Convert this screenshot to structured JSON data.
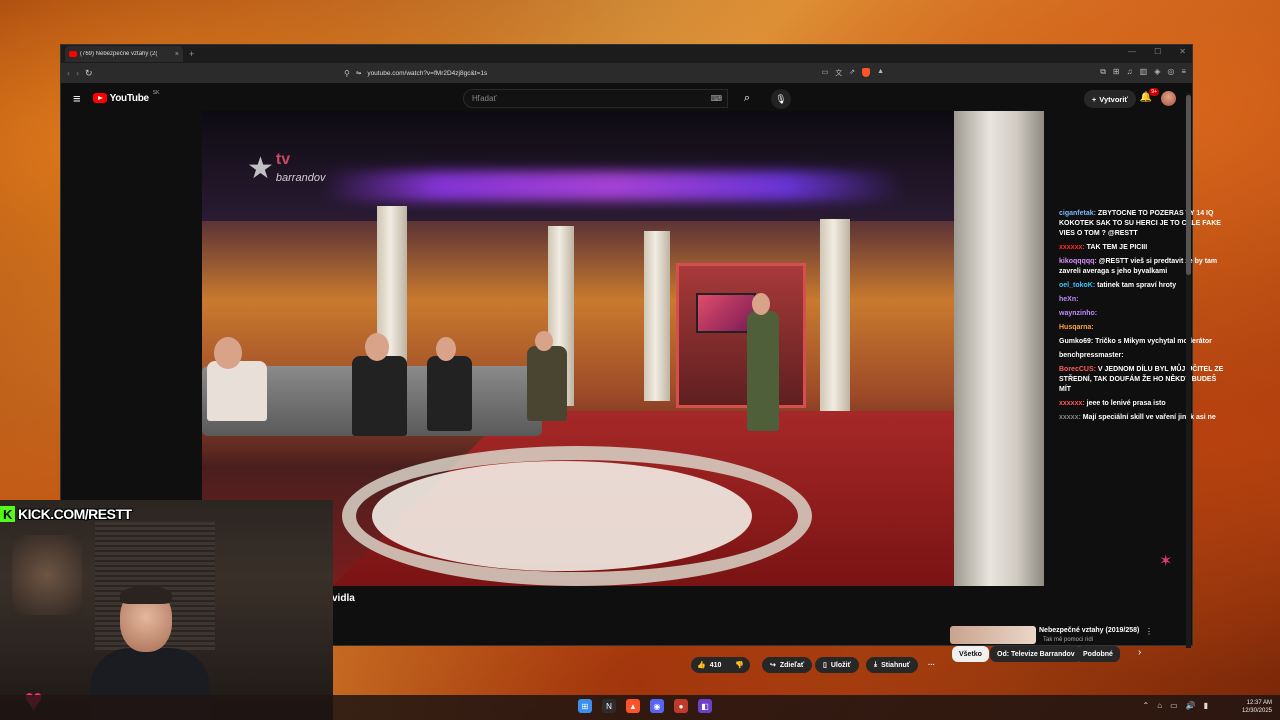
{
  "browser": {
    "tab_title": "(769) Nebezpečné vztahy (2(",
    "tab_close": "×",
    "new_tab": "+",
    "url": "youtube.com/watch?v=fMr2D4zj8gc&t=1s",
    "shield_count": "1"
  },
  "youtube": {
    "logo_text": "YouTube",
    "region": "SK",
    "search_placeholder": "Hľadať",
    "create_label": "Vytvoriť",
    "notif_badge": "9+"
  },
  "video": {
    "watermark_tv": "tv",
    "watermark_name": "barrandov",
    "title_partial": "vidla"
  },
  "chat": [
    {
      "user": "ciganfetak:",
      "text": " ZBYTOCNE TO POZERAS TY 14 IQ KOKOTEK SAK TO SU HERCI JE TO CELE FAKE VIES O TOM ? @RESTT",
      "color": "#7fb6ff"
    },
    {
      "user": "xxxxxx:",
      "text": " TAK TEM JE PICIII",
      "color": "#ff2b2b"
    },
    {
      "user": "kikoqqqqq:",
      "text": " @RESTT vieš si predtavit že by tam zavreli averaga s jeho byvalkami",
      "color": "#d98cff"
    },
    {
      "user": "oel_tokoK:",
      "text": " tatinek tam spraví hroty",
      "color": "#3cc3ff"
    },
    {
      "user": "heXn:",
      "text": "",
      "color": "#c08cff"
    },
    {
      "user": "waynzinho:",
      "text": "",
      "color": "#c08cff"
    },
    {
      "user": "Husqarna:",
      "text": "",
      "color": "#ffa13c"
    },
    {
      "user": "Gumko69:",
      "text": " Tričko s Mikym vychytal moderátor",
      "color": "#ffffff"
    },
    {
      "user": "benchpressmaster:",
      "text": "",
      "color": "#ffffff"
    },
    {
      "user": "BorecCUS:",
      "text": " V JEDNOM DÍLU BYL MŮJ UČITEL ZE STŘEDNÍ, TAK DOUFÁM ŽE HO NĚKDY BUDEŠ MÍT",
      "color": "#ff5c5c"
    },
    {
      "user": "xxxxxx:",
      "text": " jeee to lenivé prasa isto",
      "color": "#ff5c5c"
    },
    {
      "user": "xxxxx:",
      "text": " Mají speciální skill ve vaření jinak asi ne",
      "color": "#888888"
    }
  ],
  "actions": {
    "likes": "410",
    "share": "Zdieľať",
    "save": "Uložiť",
    "download": "Stiahnuť",
    "more": "···"
  },
  "chips": [
    "Všetko",
    "Od: Televize Barrandov",
    "Podobné"
  ],
  "recommendation": {
    "title": "Nebezpečné vztahy (2019/258)",
    "sub": "Tak mě pomoci ridí"
  },
  "stream": {
    "kick_label": "KICK.COM/RESTT"
  },
  "taskbar": {
    "time": "12:37 AM",
    "date": "12/30/2025"
  },
  "colors": {
    "accent": "#ff0000",
    "kick_green": "#53fc18",
    "yt_bg": "#0f0f0f"
  }
}
